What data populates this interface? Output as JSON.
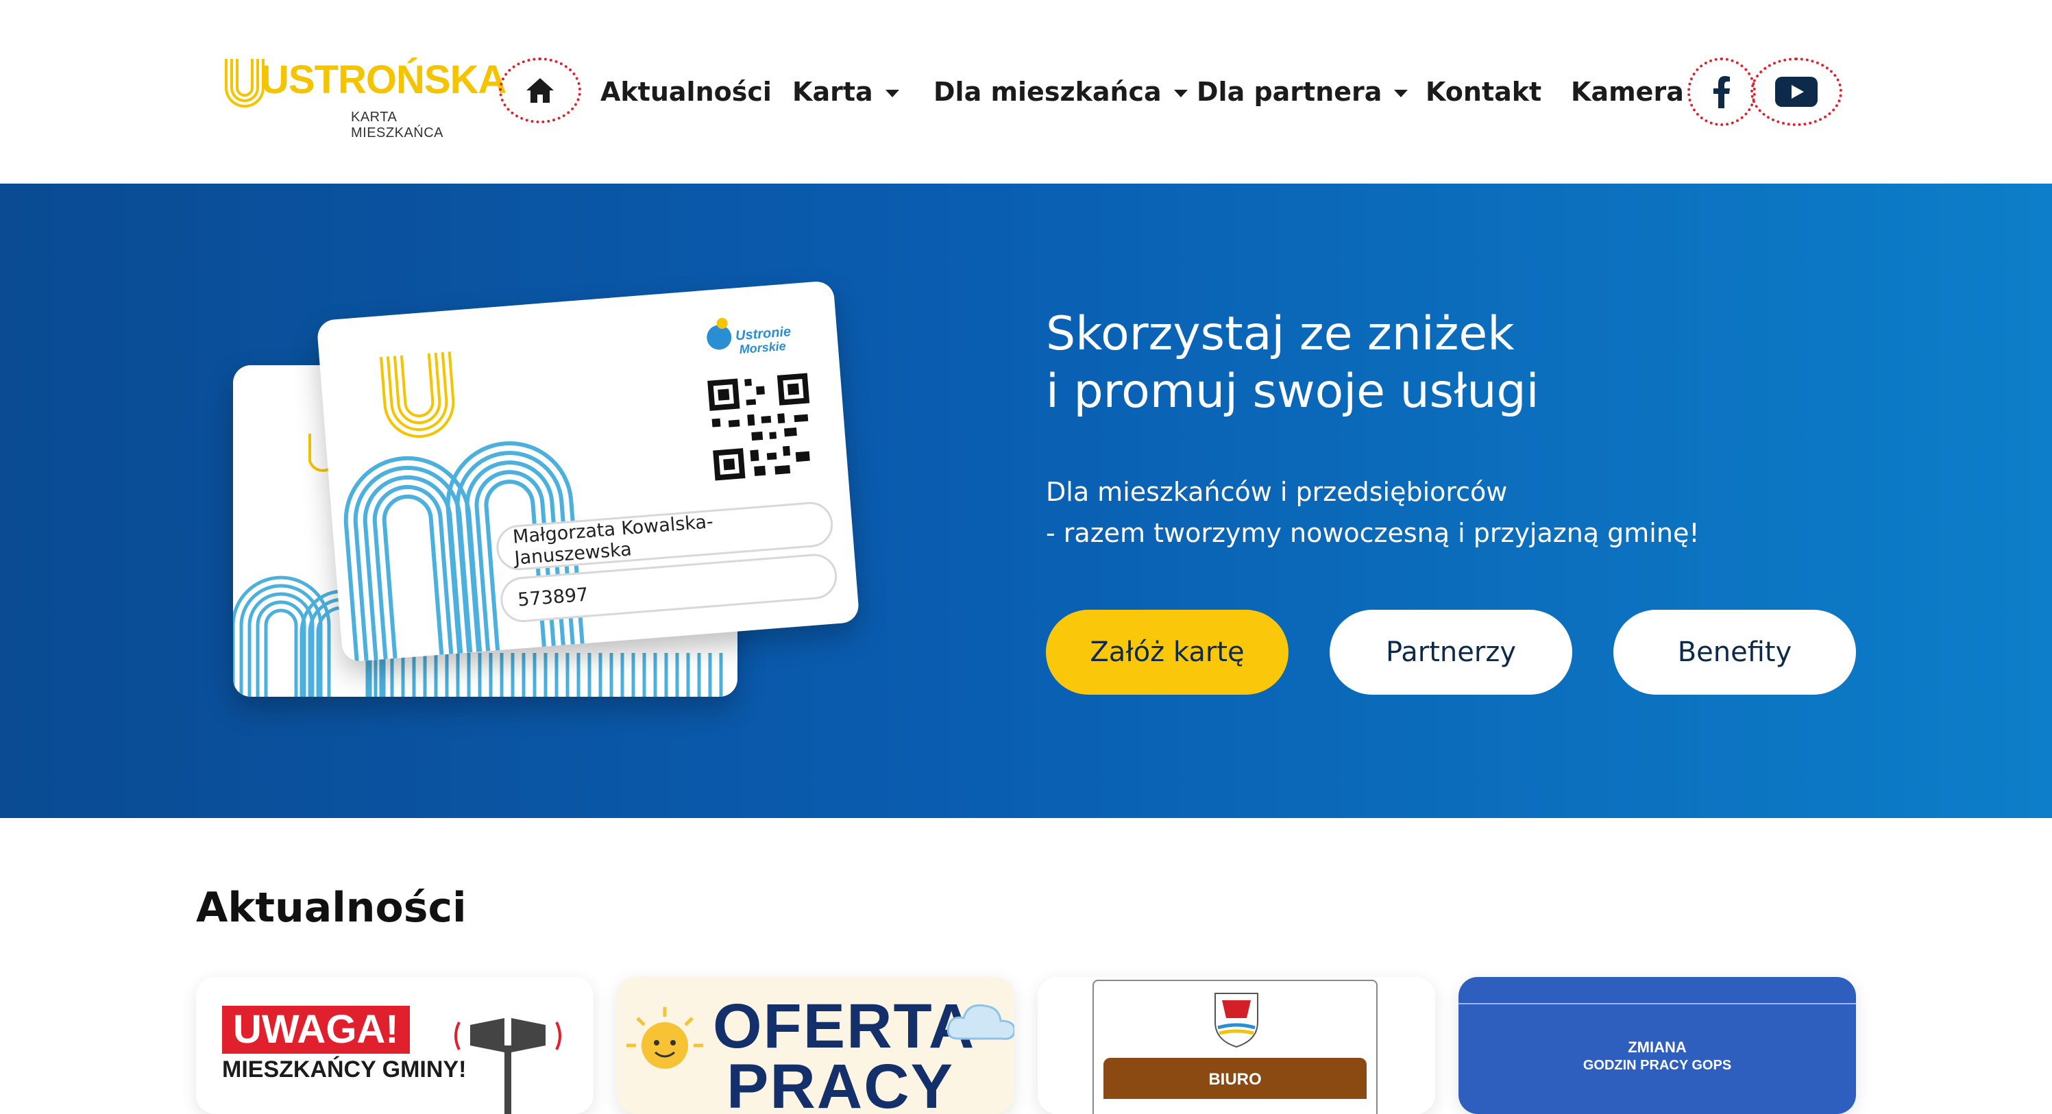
{
  "header": {
    "logo_text": "USTROŃSKA",
    "logo_subtitle": "KARTA MIESZKAŃCA",
    "nav": [
      {
        "label": "Aktualności"
      },
      {
        "label": "Karta"
      },
      {
        "label": "Dla mieszkańca"
      },
      {
        "label": "Dla partnera"
      },
      {
        "label": "Kontakt"
      },
      {
        "label": "Kamera"
      }
    ],
    "icons": {
      "home": "home-icon",
      "facebook": "facebook-icon",
      "youtube": "youtube-icon"
    }
  },
  "hero": {
    "title_line1": "Skorzystaj ze zniżek",
    "title_line2": "i promuj swoje usługi",
    "subtitle_line1": "Dla mieszkańców i przedsiębiorców",
    "subtitle_line2": "- razem tworzymy nowoczesną i przyjazną gminę!",
    "buttons": {
      "primary": "Załóż kartę",
      "partners": "Partnerzy",
      "benefits": "Benefity"
    },
    "card": {
      "brand": "Ustronie Morskie",
      "holder_name": "Małgorzata Kowalska-Januszewska",
      "card_number": "573897"
    }
  },
  "news": {
    "heading": "Aktualności",
    "items": [
      {
        "line1": "UWAGA!",
        "line2": "MIESZKAŃCY GMINY!"
      },
      {
        "line1": "OFERTA",
        "line2": "PRACY"
      },
      {
        "line1": "BIURO",
        "line2": ""
      },
      {
        "line1": "ZMIANA",
        "line2": "GODZIN PRACY GOPS"
      }
    ]
  },
  "colors": {
    "accent_yellow": "#fbc70a",
    "hero_blue": "#0a5cb0",
    "highlight_red": "#e0202c"
  }
}
